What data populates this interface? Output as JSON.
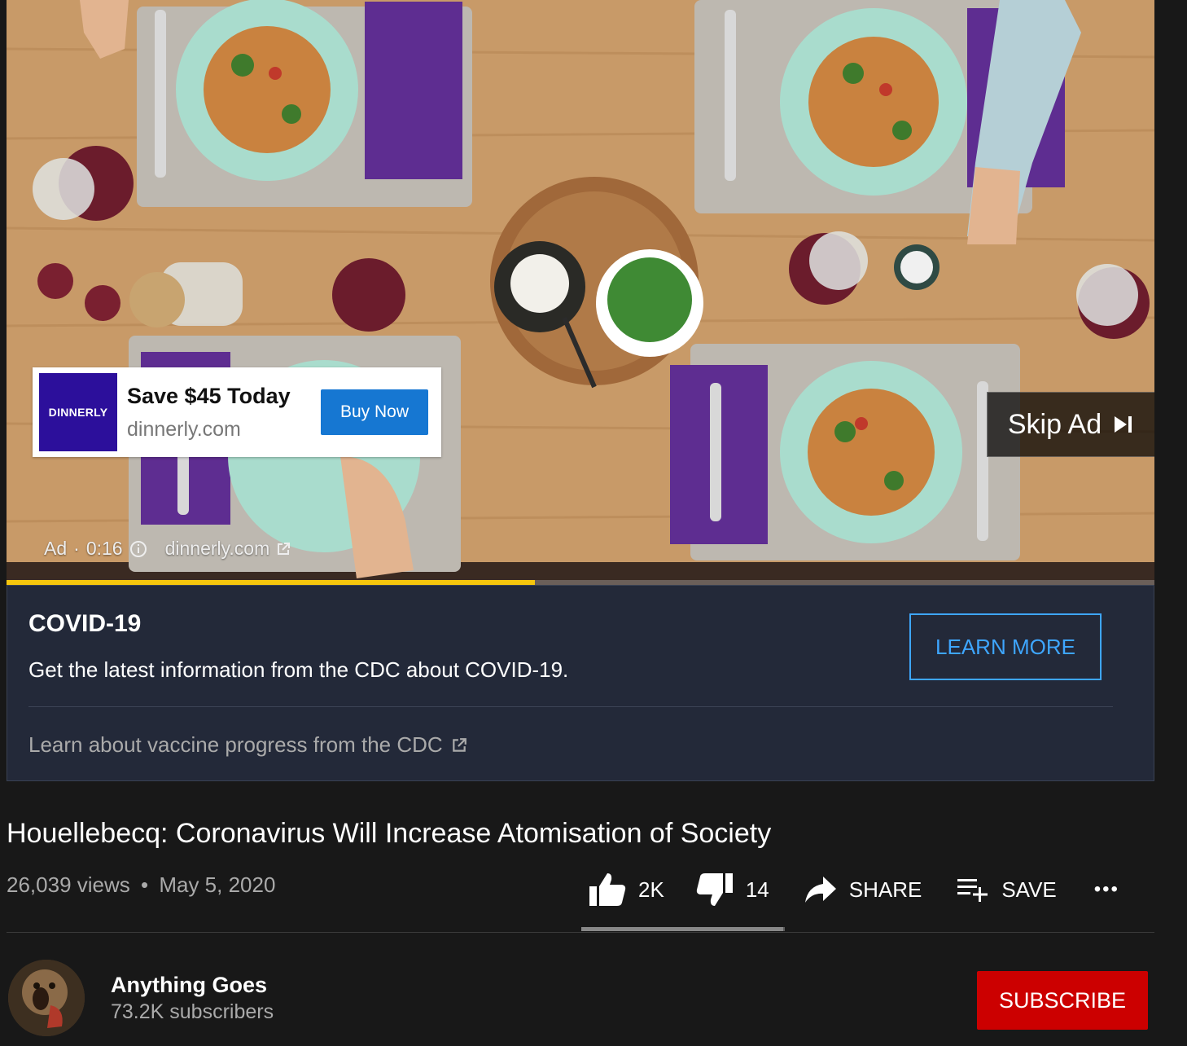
{
  "ad": {
    "logo_text": "DINNERLY",
    "title": "Save $45 Today",
    "domain": "dinnerly.com",
    "buy_label": "Buy Now",
    "skip_label": "Skip Ad",
    "label": "Ad",
    "separator": "·",
    "time": "0:16",
    "link": "dinnerly.com",
    "progress_fraction": 0.46
  },
  "covid": {
    "title": "COVID-19",
    "text": "Get the latest information from the CDC about COVID-19.",
    "learn_more": "LEARN MORE",
    "vaccine_link": "Learn about vaccine progress from the CDC"
  },
  "video": {
    "title": "Houellebecq: Coronavirus Will Increase Atomisation of Society",
    "views": "26,039 views",
    "dot": "•",
    "date": "May 5, 2020"
  },
  "actions": {
    "likes": "2K",
    "dislikes": "14",
    "share": "SHARE",
    "save": "SAVE",
    "more": "•••",
    "like_fraction": 0.99
  },
  "channel": {
    "name": "Anything Goes",
    "subscribers": "73.2K subscribers",
    "subscribe": "SUBSCRIBE"
  },
  "colors": {
    "ad_progress": "#f6c60d",
    "subscribe": "#cc0000",
    "link_blue": "#3ea6ff",
    "buy_blue": "#1677d2",
    "dinnerly_purple": "#2c0f9b"
  }
}
